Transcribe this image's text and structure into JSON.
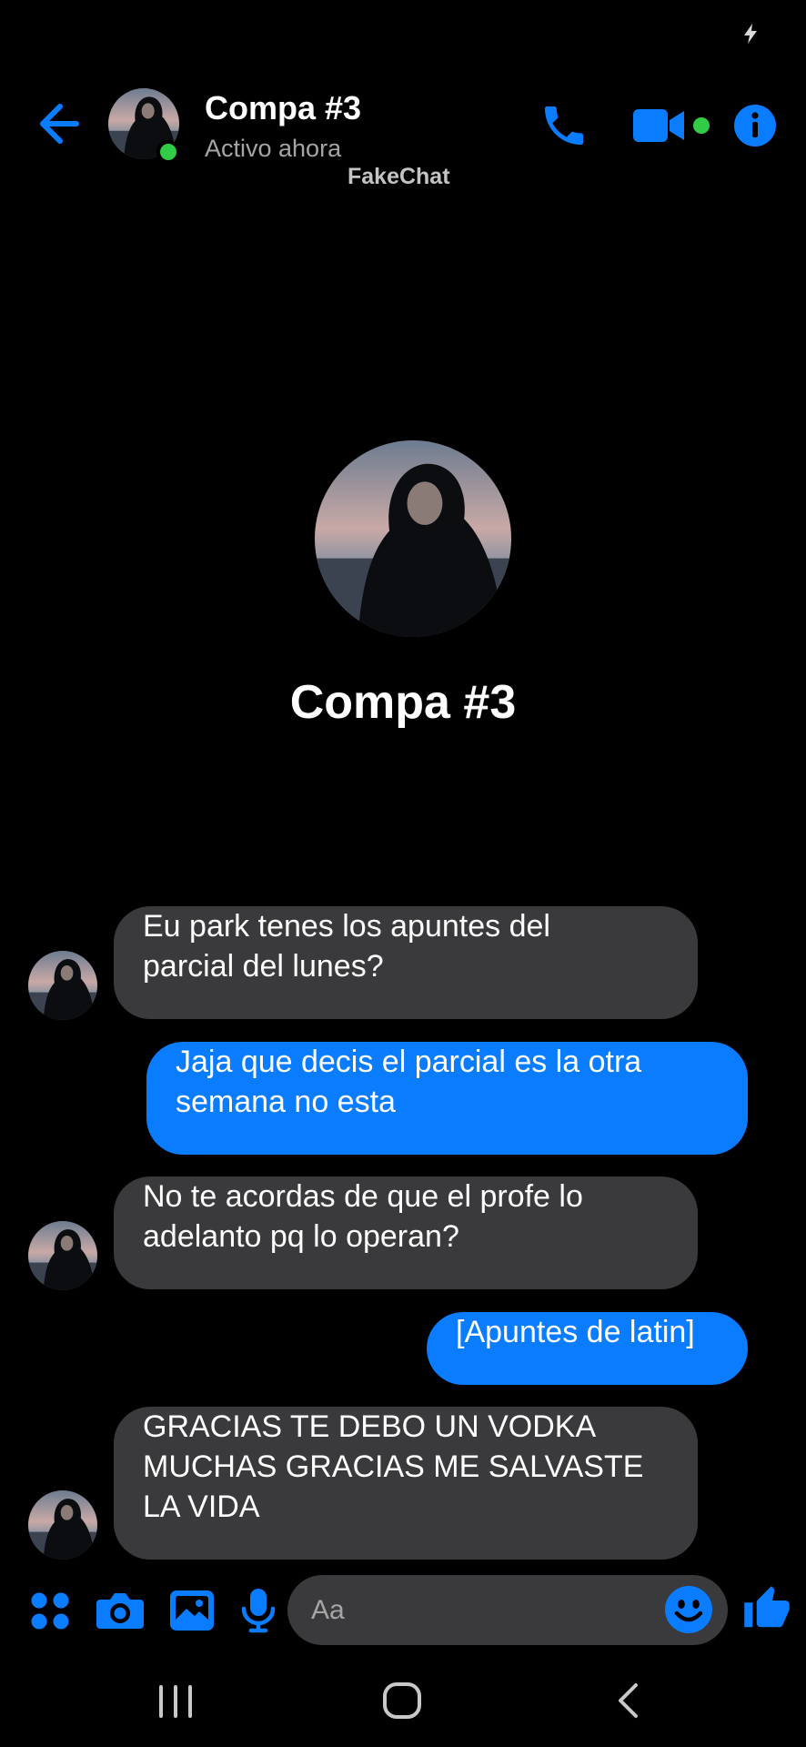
{
  "colors": {
    "accent": "#0a7cff",
    "online": "#31cc46",
    "incoming_bubble": "#3a3a3c",
    "background": "#000000"
  },
  "status_bar": {
    "icon": "charging-bolt-icon"
  },
  "header": {
    "back_icon": "arrow-left-icon",
    "contact_name": "Compa #3",
    "status": "Activo ahora",
    "watermark": "FakeChat",
    "actions": [
      "phone-icon",
      "video-camera-icon",
      "info-icon"
    ]
  },
  "profile": {
    "name": "Compa #3"
  },
  "messages": [
    {
      "direction": "incoming",
      "lines": [
        "Eu park tenes los apuntes del",
        "parcial del lunes?"
      ]
    },
    {
      "direction": "outgoing",
      "lines": [
        "Jaja que decis el parcial es la otra",
        "semana no esta"
      ]
    },
    {
      "direction": "incoming",
      "lines": [
        "No te acordas de que el profe lo",
        "adelanto pq lo operan?"
      ]
    },
    {
      "direction": "outgoing",
      "lines": [
        "[Apuntes de latin]"
      ]
    },
    {
      "direction": "incoming",
      "lines": [
        "GRACIAS TE DEBO UN VODKA",
        "MUCHAS GRACIAS ME SALVASTE",
        "LA VIDA"
      ]
    }
  ],
  "composer": {
    "placeholder": "Aa",
    "icons": [
      "apps-grid-icon",
      "camera-icon",
      "gallery-icon",
      "microphone-icon",
      "emoji-icon",
      "thumbs-up-icon"
    ]
  },
  "nav_bar": {
    "icons": [
      "recents-icon",
      "home-icon",
      "back-chevron-icon"
    ]
  }
}
